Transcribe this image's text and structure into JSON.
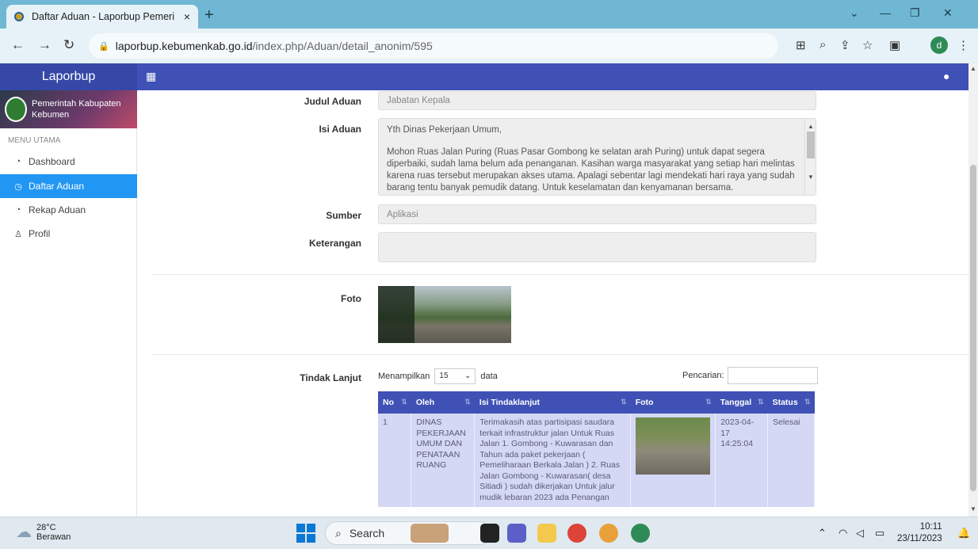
{
  "browser": {
    "tab_title": "Daftar Aduan - Laporbup Pemeri",
    "tab_close": "×",
    "new_tab": "+",
    "url_host": "laporbup.kebumenkab.go.id",
    "url_path": "/index.php/Aduan/detail_anonim/595",
    "profile_initial": "d"
  },
  "app": {
    "brand": "Laporbup"
  },
  "sidebar": {
    "banner_line1": "Pemerintah Kabupaten",
    "banner_line2": "Kebumen",
    "menu_header": "MENU UTAMA",
    "items": [
      {
        "label": "Dashboard",
        "icon": "dashboard-icon"
      },
      {
        "label": "Daftar Aduan",
        "icon": "clock-icon"
      },
      {
        "label": "Rekap Aduan",
        "icon": "dashboard-icon"
      },
      {
        "label": "Profil",
        "icon": "user-icon"
      }
    ]
  },
  "form": {
    "judul_label": "Judul Aduan",
    "judul_value": "Jabatan Kepala",
    "isi_label": "Isi Aduan",
    "isi_line1": "Yth Dinas Pekerjaan Umum,",
    "isi_para": "Mohon Ruas Jalan Puring (Ruas Pasar Gombong ke selatan arah Puring) untuk dapat segera diperbaiki, sudah lama belum ada penanganan. Kasihan warga masyarakat yang setiap hari melintas karena ruas tersebut merupakan akses utama. Apalagi sebentar lagi mendekati hari raya yang sudah barang tentu banyak pemudik datang. Untuk keselamatan dan kenyamanan bersama.",
    "sumber_label": "Sumber",
    "sumber_value": "Aplikasi",
    "keterangan_label": "Keterangan",
    "keterangan_value": "",
    "foto_label": "Foto",
    "tindak_label": "Tindak Lanjut"
  },
  "table": {
    "show_prefix": "Menampilkan",
    "page_size": "15",
    "show_suffix": "data",
    "search_label": "Pencarian:",
    "headers": [
      "No",
      "Oleh",
      "Isi Tindaklanjut",
      "Foto",
      "Tanggal",
      "Status"
    ],
    "rows": [
      {
        "no": "1",
        "oleh": "DINAS PEKERJAAN UMUM DAN PENATAAN RUANG",
        "isi": "Terimakasih atas partisipasi saudara terkait infrastruktur jalan Untuk Ruas Jalan 1. Gombong - Kuwarasan dan Tahun ada paket pekerjaan ( Pemeliharaan Berkala Jalan ) 2. Ruas Jalan Gombong - Kuwarasan( desa Sitiadi ) sudah dikerjakan Untuk jalur mudik lebaran 2023 ada Penangan",
        "tanggal": "2023-04-17 14:25:04",
        "status": "Selesai"
      }
    ]
  },
  "taskbar": {
    "temperature": "28°C",
    "weather": "Berawan",
    "search_placeholder": "Search",
    "time": "10:11",
    "date": "23/11/2023"
  },
  "colors": {
    "header": "#3f51b5",
    "active_menu": "#2196f3",
    "table_row": "#d4d8f5"
  }
}
